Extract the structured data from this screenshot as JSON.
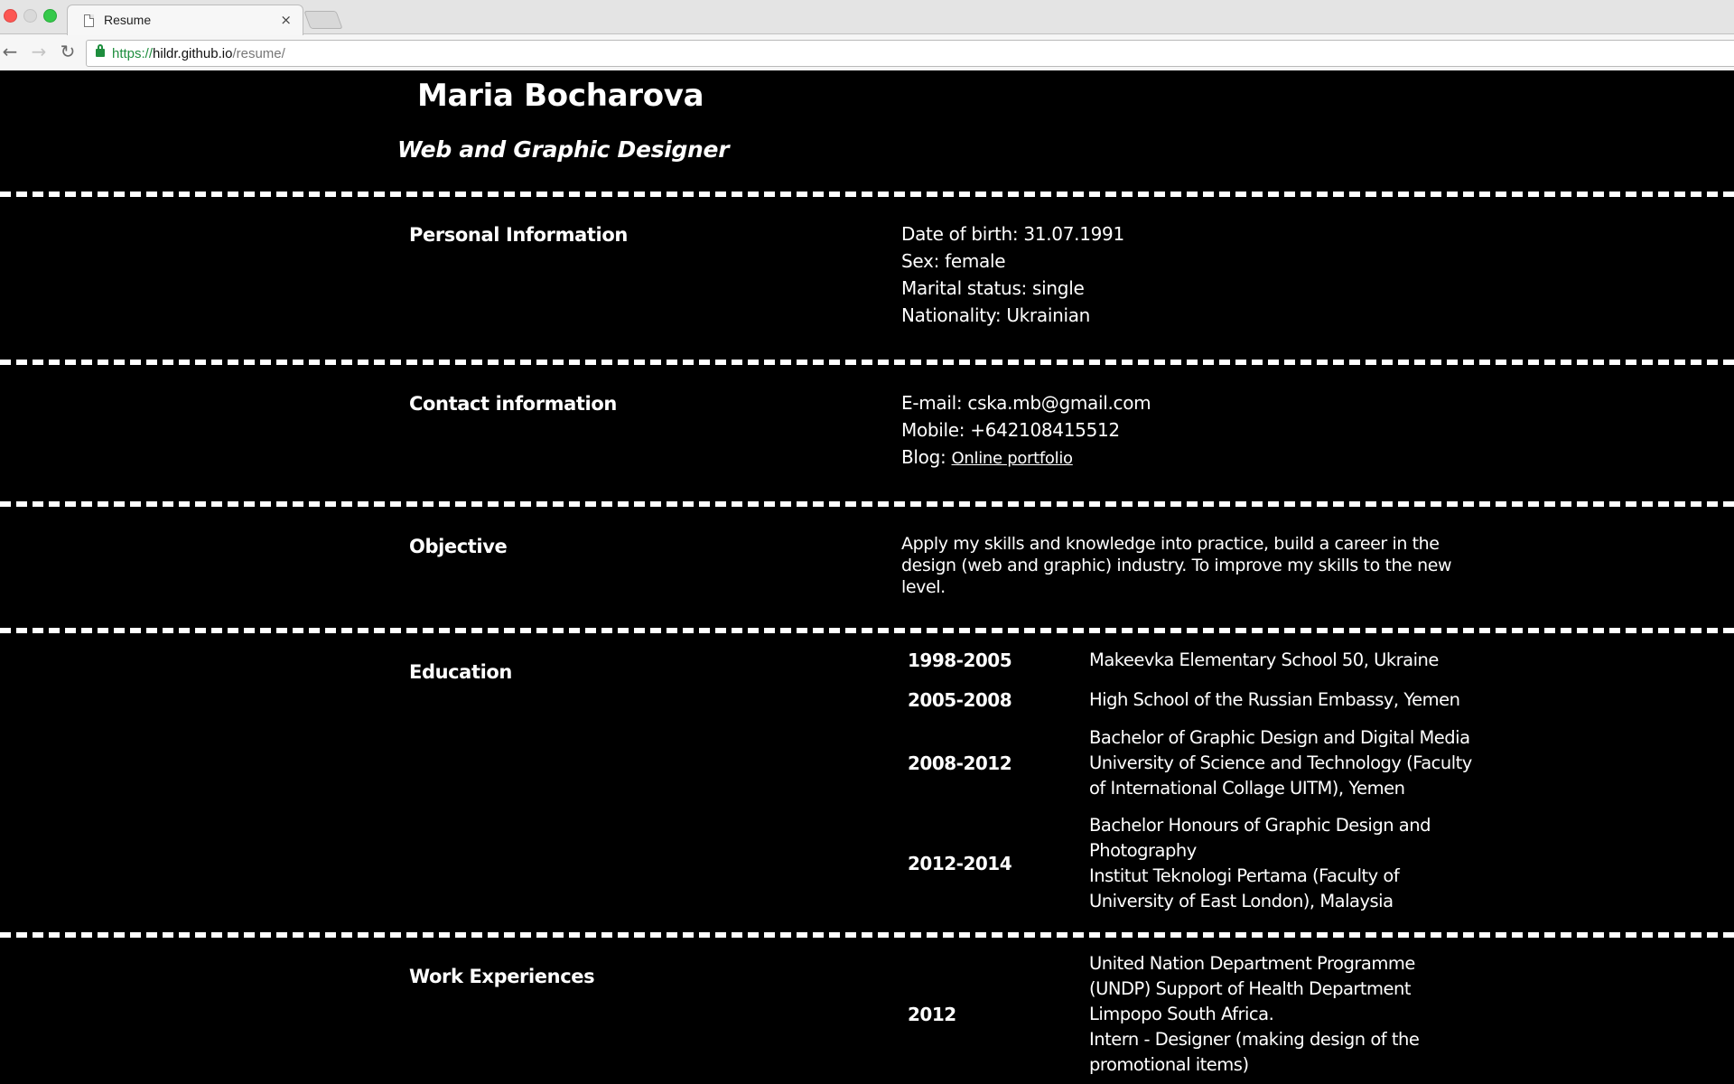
{
  "browser": {
    "tab_title": "Resume",
    "tab_close": "×",
    "url_scheme": "https://",
    "url_host": "hildr.github.io",
    "url_path": "/resume/",
    "back_glyph": "←",
    "forward_glyph": "→",
    "reload_glyph": "↻"
  },
  "header": {
    "name": "Maria Bocharova",
    "subtitle": "Web and Graphic Designer"
  },
  "personal": {
    "heading": "Personal Information",
    "dob": "Date of birth: 31.07.1991",
    "sex": "Sex: female",
    "marital": "Marital status: single",
    "nationality": "Nationality: Ukrainian"
  },
  "contact": {
    "heading": "Contact information",
    "email": "E-mail: cska.mb@gmail.com",
    "mobile": "Mobile: +642108415512",
    "blog_label": "Blog: ",
    "blog_link": "Online portfolio"
  },
  "objective": {
    "heading": "Objective",
    "text": "Apply my skills and knowledge into practice, build a career in the design (web and graphic) industry. To improve my skills to the new level."
  },
  "education": {
    "heading": "Education",
    "items": [
      {
        "years": "1998-2005",
        "lines": [
          "Makeevka Elementary School 50, Ukraine"
        ]
      },
      {
        "years": "2005-2008",
        "lines": [
          "High School of the Russian Embassy, Yemen"
        ]
      },
      {
        "years": "2008-2012",
        "lines": [
          "Bachelor of Graphic Design and Digital Media",
          "University of Science and Technology (Faculty",
          "of International Collage UITM), Yemen"
        ]
      },
      {
        "years": "2012-2014",
        "lines": [
          "Bachelor Honours of Graphic Design and",
          "Photography",
          "Institut Teknologi Pertama (Faculty of",
          "University of East London), Malaysia"
        ]
      }
    ]
  },
  "work": {
    "heading": "Work Experiences",
    "items": [
      {
        "years": "2012",
        "lines": [
          "United Nation Department Programme",
          "(UNDP) Support of Health Department",
          "Limpopo South Africa.",
          "Intern - Designer (making design of the",
          "promotional items)"
        ]
      }
    ]
  }
}
